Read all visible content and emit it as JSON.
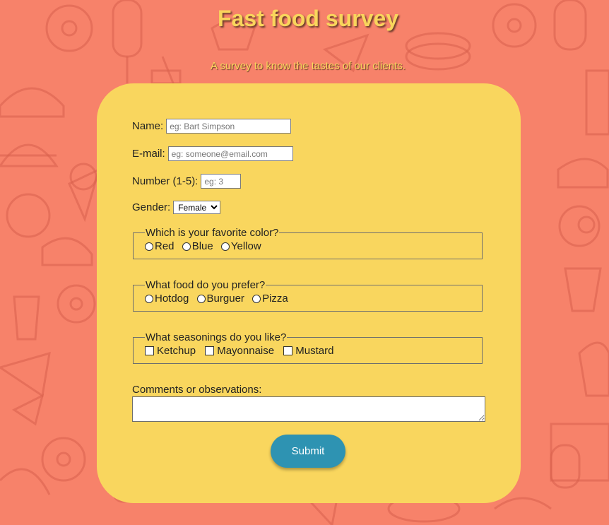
{
  "header": {
    "title": "Fast food survey",
    "subtitle": "A survey to know the tastes of our clients."
  },
  "form": {
    "name": {
      "label": "Name:",
      "placeholder": "eg: Bart Simpson"
    },
    "email": {
      "label": "E-mail:",
      "placeholder": "eg: someone@email.com"
    },
    "number": {
      "label": "Number (1-5):",
      "placeholder": "eg: 3"
    },
    "gender": {
      "label": "Gender:",
      "selected": "Female"
    },
    "color": {
      "legend": "Which is your favorite color?",
      "options": [
        "Red",
        "Blue",
        "Yellow"
      ]
    },
    "food": {
      "legend": "What food do you prefer?",
      "options": [
        "Hotdog",
        "Burguer",
        "Pizza"
      ]
    },
    "seasonings": {
      "legend": "What seasonings do you like?",
      "options": [
        "Ketchup",
        "Mayonnaise",
        "Mustard"
      ]
    },
    "comments": {
      "label": "Comments or observations:"
    },
    "submit_label": "Submit"
  },
  "colors": {
    "background": "#f7826a",
    "card": "#f9d65e",
    "title": "#f9d55c",
    "submit": "#2e93b2"
  }
}
